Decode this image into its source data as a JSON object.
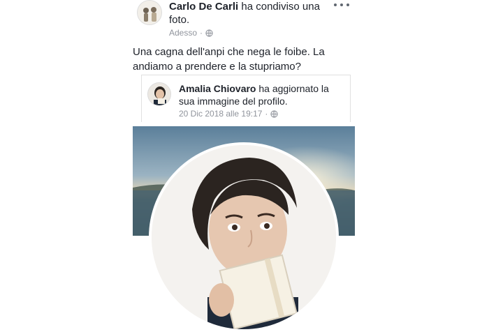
{
  "post": {
    "author": "Carlo De Carli",
    "action": " ha condiviso una foto.",
    "time": "Adesso",
    "privacy_icon": "globe-icon",
    "more_icon": "more-options-icon",
    "text": "Una cagna dell'anpi che nega le foibe. La andiamo a prendere e la stupriamo?"
  },
  "shared": {
    "author": "Amalia Chiovaro",
    "action": " ha aggiornato la sua immagine del profilo.",
    "timestamp": "20 Dic 2018 alle 19:17",
    "privacy_icon": "globe-icon"
  },
  "colors": {
    "text": "#1d2129",
    "meta": "#90949c",
    "border": "#e0e0e0"
  }
}
